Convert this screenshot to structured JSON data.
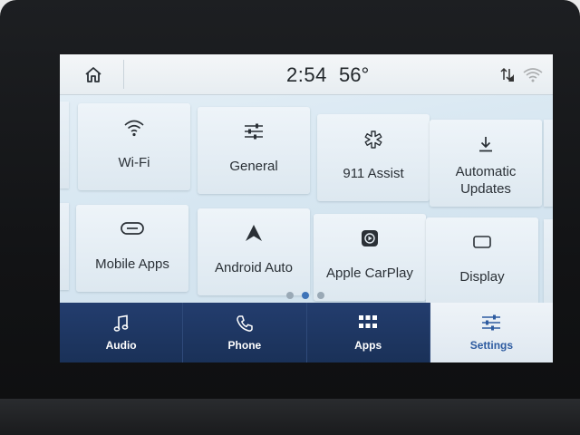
{
  "status": {
    "home_icon": "home-icon",
    "time": "2:54",
    "temperature": "56°",
    "signal_icon": "signal-arrows-icon",
    "wifi_icon": "wifi-icon"
  },
  "settings_grid": {
    "page_indicator": {
      "total": 3,
      "active": 2
    },
    "tiles": [
      {
        "label": "Wi-Fi",
        "icon": "wifi-icon"
      },
      {
        "label": "General",
        "icon": "sliders-icon"
      },
      {
        "label": "911 Assist",
        "icon": "assist-icon"
      },
      {
        "label": "Automatic Updates",
        "label_line1": "Automatic",
        "label_line2": "Updates",
        "icon": "download-icon"
      },
      {
        "label": "Mobile Apps",
        "icon": "mobile-apps-icon"
      },
      {
        "label": "Android Auto",
        "icon": "android-auto-icon"
      },
      {
        "label": "Apple CarPlay",
        "icon": "carplay-icon"
      },
      {
        "label": "Display",
        "icon": "display-icon"
      }
    ]
  },
  "navbar": {
    "items": [
      {
        "label": "Audio",
        "icon": "music-note-icon",
        "active": false
      },
      {
        "label": "Phone",
        "icon": "phone-icon",
        "active": false
      },
      {
        "label": "Apps",
        "icon": "apps-grid-icon",
        "active": false
      },
      {
        "label": "Settings",
        "icon": "sliders-icon",
        "active": true
      }
    ]
  },
  "colors": {
    "nav_background": "#1c3460",
    "nav_active_text": "#2d5ba0",
    "page_dot_active": "#3f74b8"
  }
}
